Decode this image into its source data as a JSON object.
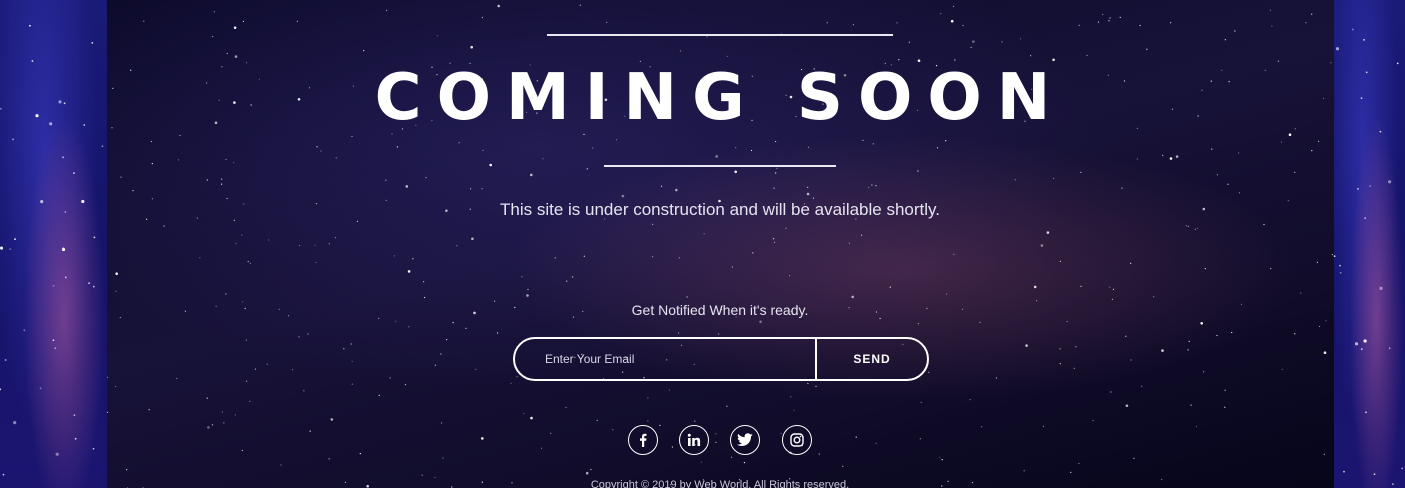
{
  "hero": {
    "title": "COMING SOON",
    "subtitle": "This site is under construction and will be available shortly."
  },
  "notify": {
    "label": "Get Notified When it's ready.",
    "email_placeholder": "Enter Your Email",
    "send_label": "SEND"
  },
  "social": {
    "icons": [
      "facebook-icon",
      "linkedin-icon",
      "twitter-icon",
      "instagram-icon"
    ]
  },
  "footer": {
    "copyright": "Copyright © 2019 by Web World. All Rights reserved."
  },
  "colors": {
    "text": "#ffffff",
    "background": "#120d2c",
    "side_panels": "#1a1a78"
  }
}
